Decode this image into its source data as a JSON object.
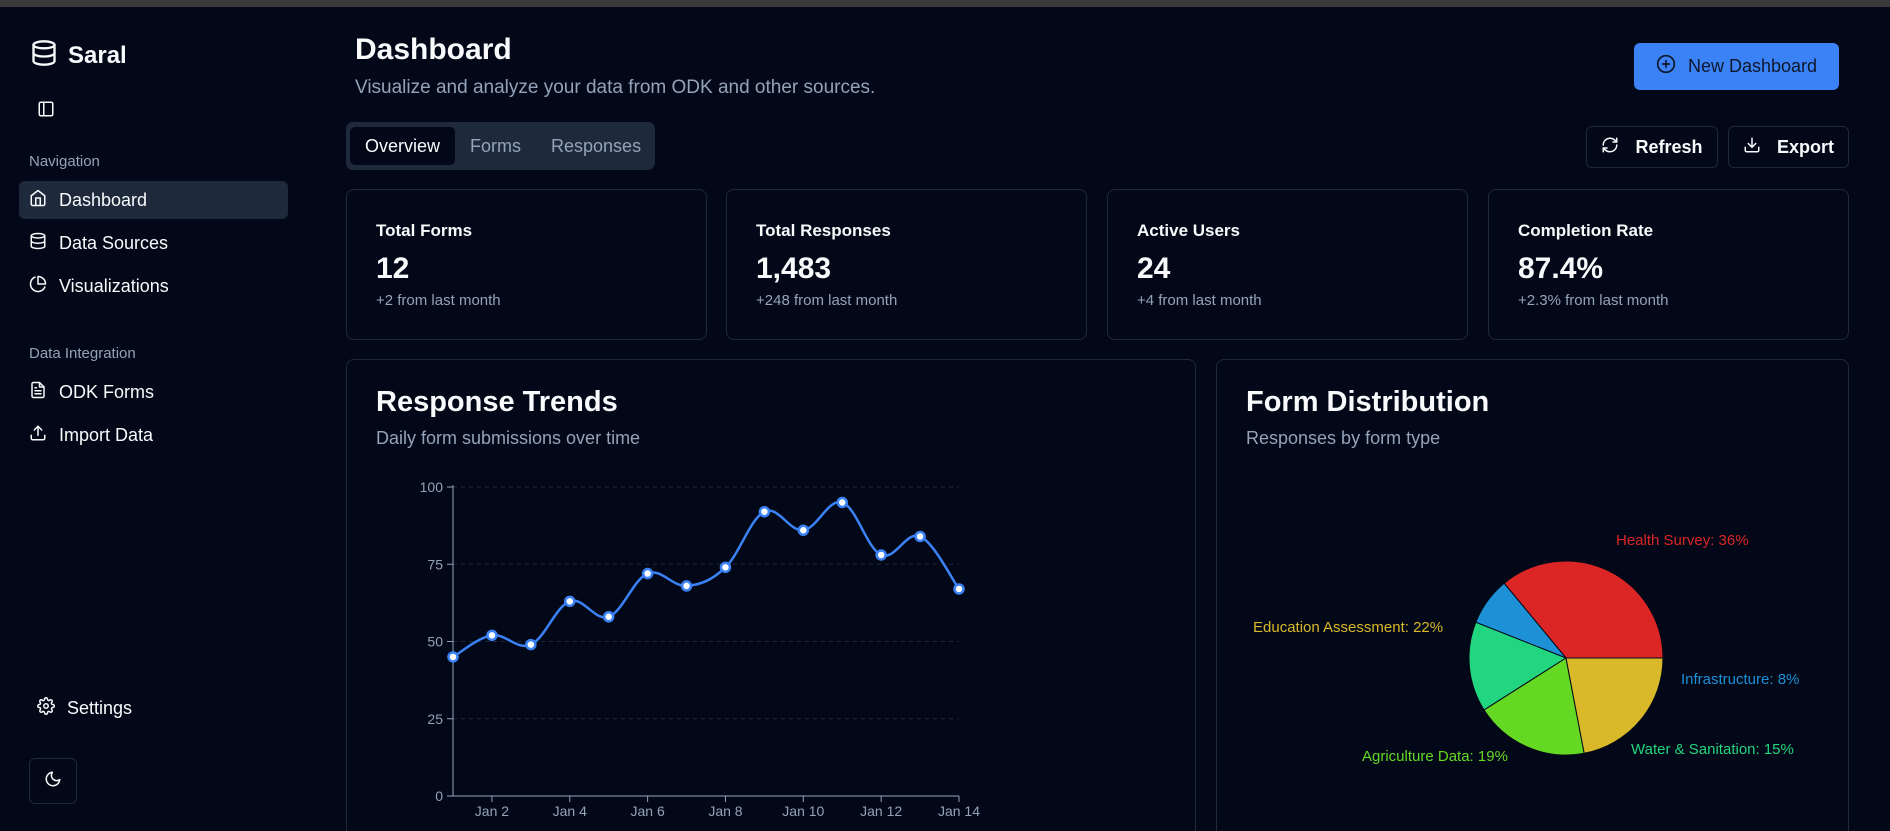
{
  "app": {
    "name": "Saral"
  },
  "sidebar": {
    "sections": [
      {
        "label": "Navigation"
      },
      {
        "label": "Data Integration"
      }
    ],
    "items": [
      {
        "label": "Dashboard",
        "icon": "home-icon",
        "active": true
      },
      {
        "label": "Data Sources",
        "icon": "database-icon"
      },
      {
        "label": "Visualizations",
        "icon": "pie-chart-icon"
      },
      {
        "label": "ODK Forms",
        "icon": "file-text-icon"
      },
      {
        "label": "Import Data",
        "icon": "upload-icon"
      }
    ],
    "settings_label": "Settings"
  },
  "header": {
    "title": "Dashboard",
    "subtitle": "Visualize and analyze your data from ODK and other sources.",
    "new_dashboard_label": "New Dashboard"
  },
  "tabs": [
    {
      "label": "Overview",
      "active": true
    },
    {
      "label": "Forms"
    },
    {
      "label": "Responses"
    }
  ],
  "actions": {
    "refresh_label": "Refresh",
    "export_label": "Export"
  },
  "stats": [
    {
      "title": "Total Forms",
      "value": "12",
      "change": "+2 from last month"
    },
    {
      "title": "Total Responses",
      "value": "1,483",
      "change": "+248 from last month"
    },
    {
      "title": "Active Users",
      "value": "24",
      "change": "+4 from last month"
    },
    {
      "title": "Completion Rate",
      "value": "87.4%",
      "change": "+2.3% from last month"
    }
  ],
  "trends_card": {
    "title": "Response Trends",
    "subtitle": "Daily form submissions over time"
  },
  "distribution_card": {
    "title": "Form Distribution",
    "subtitle": "Responses by form type"
  },
  "colors": {
    "background": "#020817",
    "accent": "#3b82f6",
    "line": "#3b82f6",
    "border": "#1e293b",
    "muted_text": "#94a3b8"
  },
  "chart_data": [
    {
      "type": "line",
      "x": [
        "Jan 1",
        "Jan 2",
        "Jan 3",
        "Jan 4",
        "Jan 5",
        "Jan 6",
        "Jan 7",
        "Jan 8",
        "Jan 9",
        "Jan 10",
        "Jan 11",
        "Jan 12",
        "Jan 13",
        "Jan 14"
      ],
      "x_tick_labels": [
        "Jan 2",
        "Jan 4",
        "Jan 6",
        "Jan 8",
        "Jan 10",
        "Jan 12",
        "Jan 14"
      ],
      "series": [
        {
          "values": [
            45,
            52,
            49,
            63,
            58,
            72,
            68,
            74,
            92,
            86,
            95,
            78,
            84,
            67
          ]
        }
      ],
      "ylim": [
        0,
        100
      ],
      "y_ticks": [
        0,
        25,
        50,
        75,
        100
      ],
      "grid": true
    },
    {
      "type": "pie",
      "slices": [
        {
          "label": "Health Survey: 36%",
          "value": 36,
          "color": "#dc2626"
        },
        {
          "label": "Infrastructure: 8%",
          "value": 8,
          "color": "#1e90d6"
        },
        {
          "label": "Water & Sanitation: 15%",
          "value": 15,
          "color": "#22d57f"
        },
        {
          "label": "Agriculture Data: 19%",
          "value": 19,
          "color": "#65d823"
        },
        {
          "label": "Education Assessment: 22%",
          "value": 22,
          "color": "#d9b92a"
        }
      ]
    }
  ]
}
